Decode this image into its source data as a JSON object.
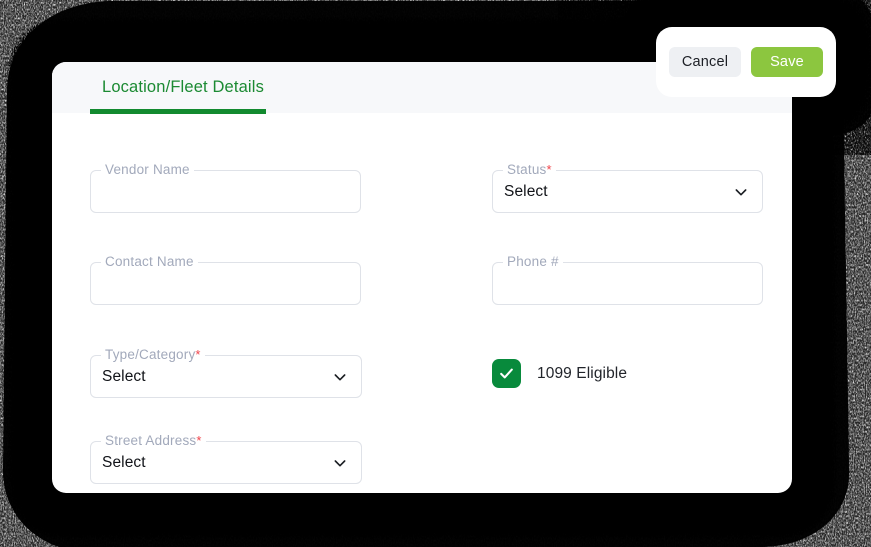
{
  "window": {
    "title": "Location/Fleet Details"
  },
  "actionbar": {
    "cancel_label": "Cancel",
    "save_label": "Save",
    "cancel_bg": "#eef0f3",
    "save_bg": "#8cc63f"
  },
  "tabs": [
    {
      "label": "Location/Fleet Details",
      "active": true,
      "accent_color": "#128a2f"
    }
  ],
  "form": {
    "required_marker": "*",
    "chevron_icon": "chevron-down-icon",
    "fields": [
      {
        "name": "vendor-name",
        "label": "Vendor Name",
        "type": "text",
        "required": false,
        "value": "",
        "placeholder": ""
      },
      {
        "name": "status",
        "label": "Status",
        "type": "select",
        "required": true,
        "value": "Select"
      },
      {
        "name": "contact-name",
        "label": "Contact Name",
        "type": "text",
        "required": false,
        "value": "",
        "placeholder": ""
      },
      {
        "name": "phone-number",
        "label": "Phone #",
        "type": "text",
        "required": false,
        "value": "",
        "placeholder": ""
      },
      {
        "name": "type-category",
        "label": "Type/Category",
        "type": "select",
        "required": true,
        "value": "Select"
      },
      {
        "name": "street-address",
        "label": "Street Address",
        "type": "select",
        "required": true,
        "value": "Select"
      }
    ],
    "checkbox": {
      "name": "1099-eligible",
      "label": "1099 Eligible",
      "checked": true,
      "checked_color": "#088a3c",
      "check_icon": "checkmark-icon"
    }
  },
  "colors": {
    "card_bg": "#ffffff",
    "tabbar_bg": "#f7f8fa",
    "field_border": "#dfe2e8",
    "label_text": "#a2a9bb",
    "value_text": "#111318",
    "required_red": "#f0434a",
    "tab_green": "#1b8a32"
  }
}
